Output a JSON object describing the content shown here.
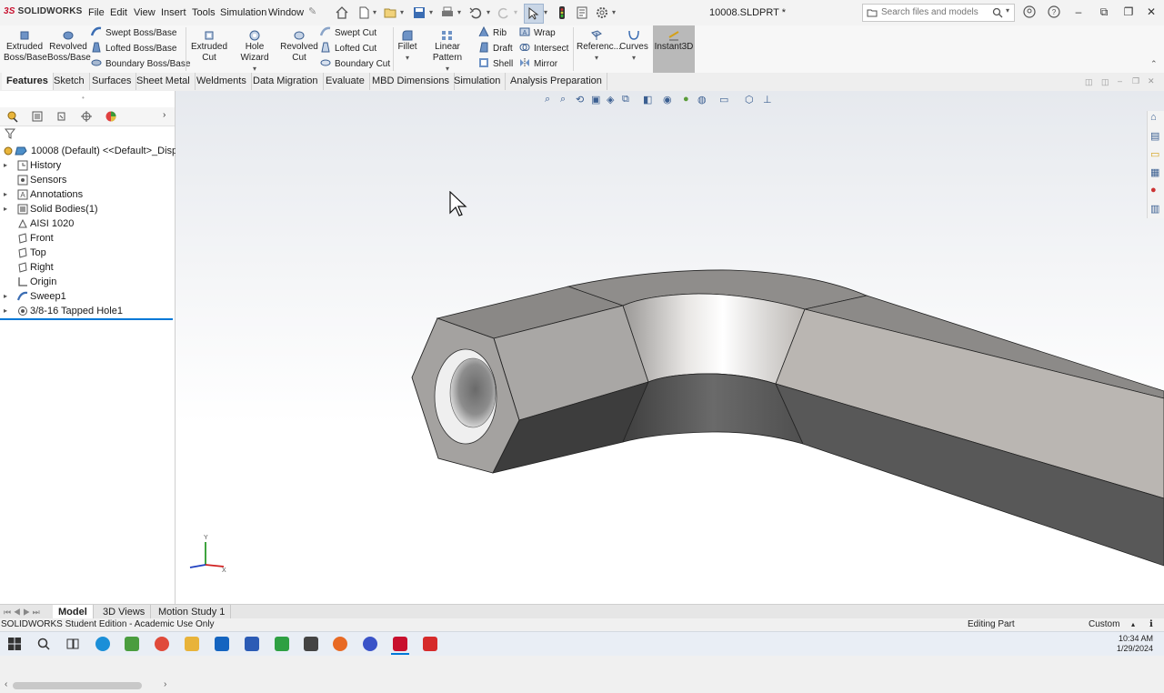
{
  "app": {
    "logo_ds": "3S",
    "logo_text": "SOLIDWORKS",
    "document_title": "10008.SLDPRT *"
  },
  "menu": [
    "File",
    "Edit",
    "View",
    "Insert",
    "Tools",
    "Simulation",
    "Window"
  ],
  "search": {
    "placeholder": "Search files and models"
  },
  "command_manager": {
    "extruded_boss": "Extruded\nBoss/Base",
    "revolved_boss": "Revolved\nBoss/Base",
    "swept_boss": "Swept Boss/Base",
    "lofted_boss": "Lofted Boss/Base",
    "boundary_boss": "Boundary Boss/Base",
    "extruded_cut": "Extruded\nCut",
    "hole_wizard": "Hole Wizard",
    "revolved_cut": "Revolved\nCut",
    "swept_cut": "Swept Cut",
    "lofted_cut": "Lofted Cut",
    "boundary_cut": "Boundary Cut",
    "fillet": "Fillet",
    "linear_pattern": "Linear Pattern",
    "rib": "Rib",
    "draft": "Draft",
    "shell": "Shell",
    "wrap": "Wrap",
    "intersect": "Intersect",
    "mirror": "Mirror",
    "reference": "Referenc...",
    "curves": "Curves",
    "instant3d": "Instant3D"
  },
  "tabs": [
    "Features",
    "Sketch",
    "Surfaces",
    "Sheet Metal",
    "Weldments",
    "Data Migration",
    "Evaluate",
    "MBD Dimensions",
    "Simulation",
    "Analysis Preparation"
  ],
  "active_tab": "Features",
  "feature_tree": {
    "root": "10008 (Default) <<Default>_Displa",
    "items": [
      {
        "label": "History",
        "expandable": true,
        "icon": "history-icon"
      },
      {
        "label": "Sensors",
        "expandable": false,
        "icon": "sensors-icon"
      },
      {
        "label": "Annotations",
        "expandable": true,
        "icon": "annotations-icon"
      },
      {
        "label": "Solid Bodies(1)",
        "expandable": true,
        "icon": "solid-bodies-icon"
      },
      {
        "label": "AISI 1020",
        "expandable": false,
        "icon": "material-icon"
      },
      {
        "label": "Front",
        "expandable": false,
        "icon": "plane-icon"
      },
      {
        "label": "Top",
        "expandable": false,
        "icon": "plane-icon"
      },
      {
        "label": "Right",
        "expandable": false,
        "icon": "plane-icon"
      },
      {
        "label": "Origin",
        "expandable": false,
        "icon": "origin-icon"
      },
      {
        "label": "Sweep1",
        "expandable": true,
        "icon": "sweep-icon"
      },
      {
        "label": "3/8-16 Tapped Hole1",
        "expandable": true,
        "icon": "hole-icon"
      }
    ]
  },
  "bottom_tabs": [
    "Model",
    "3D Views",
    "Motion Study 1"
  ],
  "active_bottom_tab": "Model",
  "status": {
    "left": "SOLIDWORKS Student Edition - Academic Use Only",
    "mode": "Editing Part",
    "units": "Custom"
  },
  "taskbar": {
    "time": "10:34 AM",
    "date": "1/29/2024"
  },
  "triad": {
    "y_label": "Y",
    "x_label": "X"
  },
  "colors": {
    "accent_red": "#c8102e",
    "selected_blue": "#0078d7"
  }
}
